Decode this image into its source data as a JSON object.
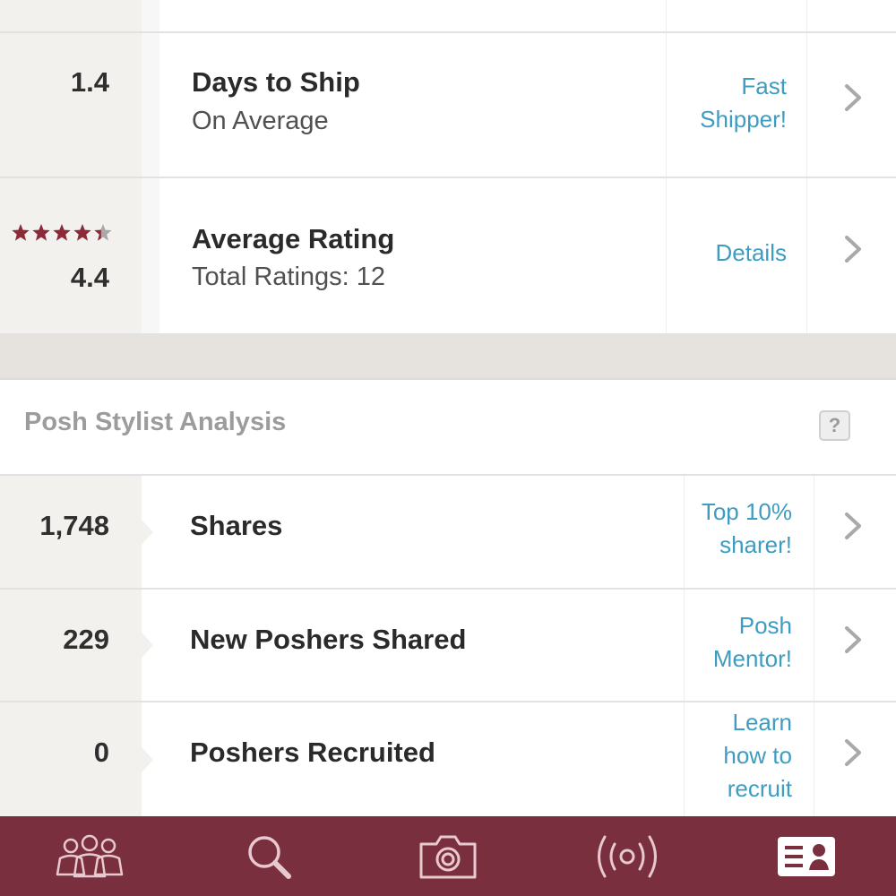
{
  "shipping": {
    "value": "1.4",
    "title": "Days to Ship",
    "subtitle": "On Average",
    "action_line1": "Fast",
    "action_line2": "Shipper!"
  },
  "rating": {
    "stars": 4.4,
    "value": "4.4",
    "title": "Average Rating",
    "subtitle": "Total Ratings: 12",
    "action": "Details"
  },
  "stylist_section": {
    "title": "Posh Stylist Analysis",
    "help_label": "?"
  },
  "shares": {
    "value": "1,748",
    "title": "Shares",
    "action_line1": "Top 10%",
    "action_line2": "sharer!"
  },
  "new_poshers": {
    "value": "229",
    "title": "New Poshers Shared",
    "action_line1": "Posh",
    "action_line2": "Mentor!"
  },
  "recruited": {
    "value": "0",
    "title": "Poshers Recruited",
    "action_line1": "Learn",
    "action_line2": "how to",
    "action_line3": "recruit"
  },
  "tabbar": {
    "tabs": [
      {
        "icon": "community-icon"
      },
      {
        "icon": "search-icon"
      },
      {
        "icon": "camera-icon"
      },
      {
        "icon": "broadcast-icon"
      },
      {
        "icon": "profile-card-icon",
        "active": true
      }
    ]
  },
  "colors": {
    "accent": "#3f9cc1",
    "tabbar": "#7a2f3e",
    "star": "#8c2a38"
  }
}
